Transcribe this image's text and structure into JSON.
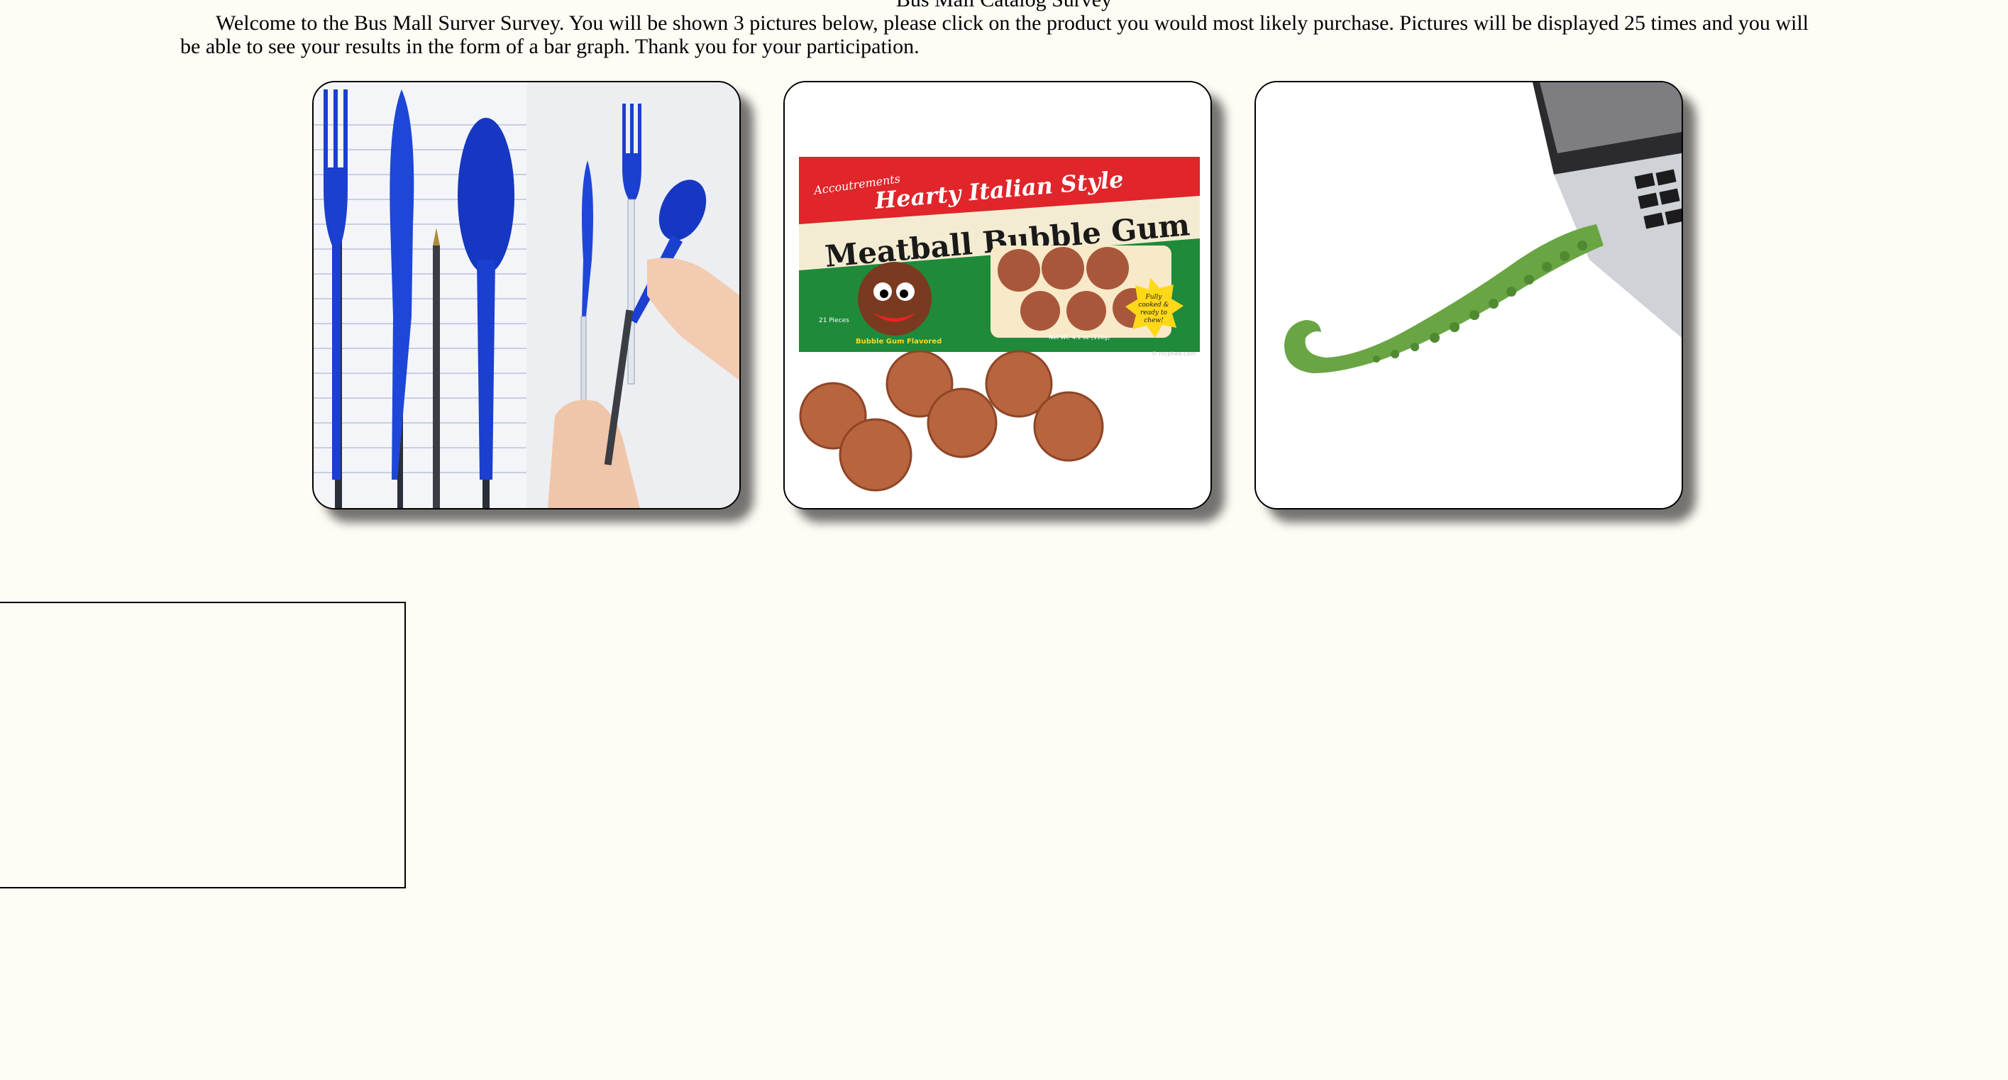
{
  "header": {
    "title": "Bus Mall Catalog Survey",
    "intro": "Welcome to the Bus Mall Surver Survey. You will be shown 3 pictures below, please click on the product you would most likely purchase. Pictures will be displayed 25 times and you will be able to see your results in the form of a bar graph. Thank you for your participation."
  },
  "products": [
    {
      "icon": "pen-utensils-icon"
    },
    {
      "icon": "meatball-bubble-gum-icon",
      "package": {
        "brand": "Accoutrements",
        "line1": "Hearty Italian Style",
        "line2": "Meatball Bubble Gum",
        "pieces": "21 Pieces",
        "flavor": "Bubble Gum Flavored",
        "weight": "Net Wt. 4.1 oz (116g)",
        "badge1": "Fully",
        "badge2": "cooked &",
        "badge3": "ready to",
        "badge4": "chew!",
        "site": "© mcphee.com"
      }
    },
    {
      "icon": "tentacle-usb-icon"
    }
  ],
  "results_chart": {
    "icon": "bar-graph-canvas"
  },
  "colors": {
    "background": "#fffcf6",
    "utensil_blue": "#1b3fcf",
    "gum_green": "#1e8a3a",
    "gum_red": "#e0252b",
    "tentacle_green": "#6aa544"
  }
}
